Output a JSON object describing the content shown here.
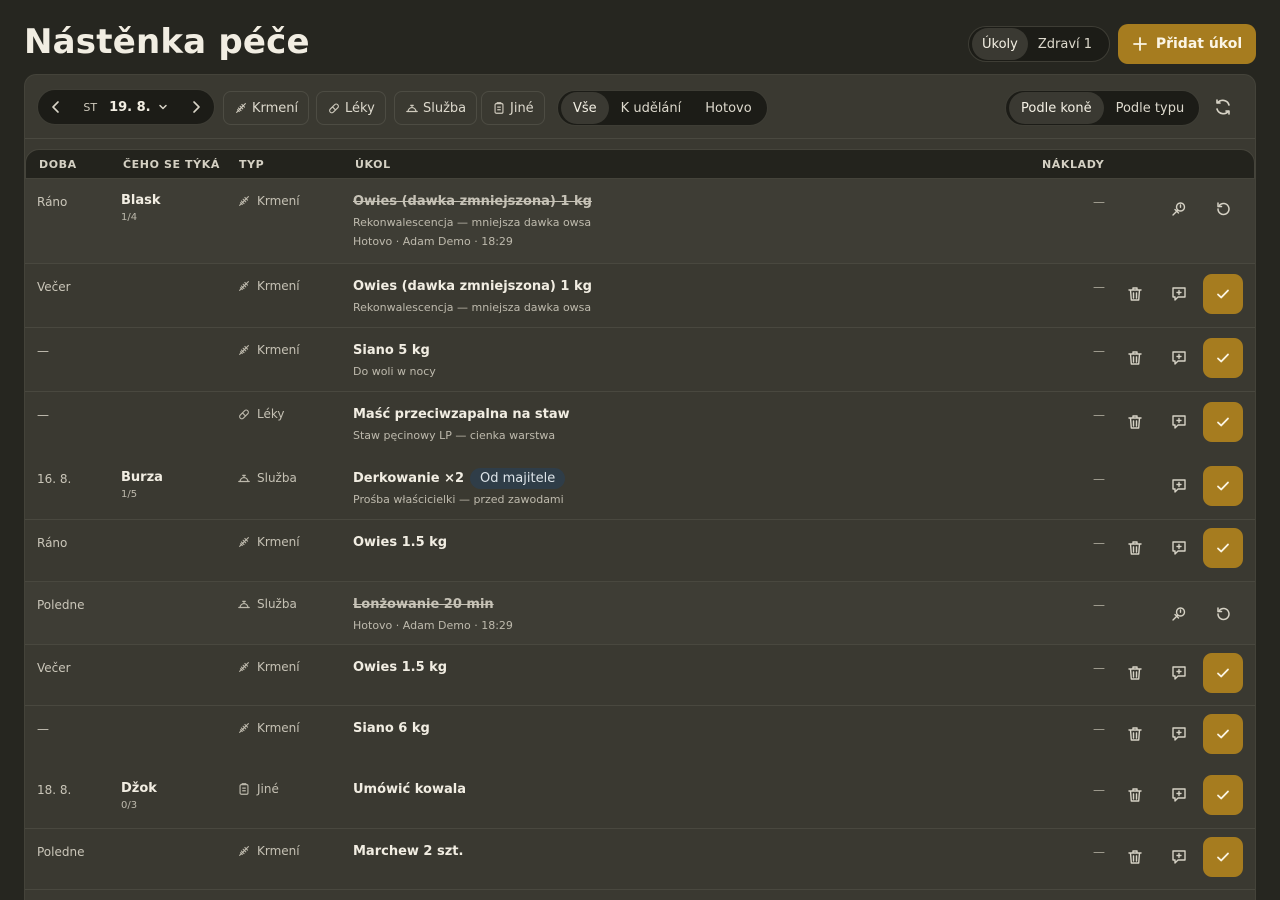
{
  "header": {
    "title": "Nástěnka péče",
    "view_tabs": [
      {
        "label": "Úkoly",
        "active": true
      },
      {
        "label": "Zdraví 1",
        "active": false
      }
    ],
    "add_button_label": "Přidat úkol"
  },
  "toolbar": {
    "date": {
      "weekday": "ST",
      "value": "19. 8."
    },
    "type_chips": [
      {
        "label": "Krmení",
        "icon": "feed-icon"
      },
      {
        "label": "Léky",
        "icon": "pill-icon"
      },
      {
        "label": "Služba",
        "icon": "service-bell-icon"
      },
      {
        "label": "Jiné",
        "icon": "clipboard-icon"
      }
    ],
    "status_filter": [
      {
        "label": "Vše",
        "active": true
      },
      {
        "label": "K udělání",
        "active": false
      },
      {
        "label": "Hotovo",
        "active": false
      }
    ],
    "sort": [
      {
        "label": "Podle koně",
        "active": true
      },
      {
        "label": "Podle typu",
        "active": false
      }
    ]
  },
  "table": {
    "columns": [
      "DOBA",
      "ČEHO SE TÝKÁ",
      "TYP",
      "ÚKOL",
      "NÁKLADY"
    ],
    "rows": [
      {
        "time": "Ráno",
        "horse": "Blask",
        "horse_count": "1/4",
        "type": "Krmení",
        "title": "Owies (dawka zmniejszona) 1 kg",
        "note": "Rekonwalescencja — mniejsza dawka owsa",
        "meta": "Hotovo · Adam Demo · 18:29",
        "cost": "—",
        "done": true
      },
      {
        "time": "Večer",
        "horse": "",
        "horse_count": "",
        "type": "Krmení",
        "title": "Owies (dawka zmniejszona) 1 kg",
        "note": "Rekonwalescencja — mniejsza dawka owsa",
        "meta": "",
        "cost": "—",
        "done": false
      },
      {
        "time": "—",
        "horse": "",
        "horse_count": "",
        "type": "Krmení",
        "title": "Siano 5 kg",
        "note": "Do woli w nocy",
        "meta": "",
        "cost": "—",
        "done": false
      },
      {
        "time": "—",
        "horse": "",
        "horse_count": "",
        "type": "Léky",
        "title": "Maść przeciwzapalna na staw",
        "note": "Staw pęcinowy LP — cienka warstwa",
        "meta": "",
        "cost": "—",
        "done": false
      },
      {
        "time": "16. 8.",
        "horse": "Burza",
        "horse_count": "1/5",
        "type": "Služba",
        "title": "Derkowanie ×2",
        "badge": "Od majitele",
        "note": "Prośba właścicielki — przed zawodami",
        "meta": "",
        "cost": "—",
        "done": false
      },
      {
        "time": "Ráno",
        "horse": "",
        "horse_count": "",
        "type": "Krmení",
        "title": "Owies 1.5 kg",
        "note": "",
        "meta": "",
        "cost": "—",
        "done": false
      },
      {
        "time": "Poledne",
        "horse": "",
        "horse_count": "",
        "type": "Služba",
        "title": "Lonżowanie 20 min",
        "note": "",
        "meta": "Hotovo · Adam Demo · 18:29",
        "cost": "—",
        "done": true
      },
      {
        "time": "Večer",
        "horse": "",
        "horse_count": "",
        "type": "Krmení",
        "title": "Owies 1.5 kg",
        "note": "",
        "meta": "",
        "cost": "—",
        "done": false
      },
      {
        "time": "—",
        "horse": "",
        "horse_count": "",
        "type": "Krmení",
        "title": "Siano 6 kg",
        "note": "",
        "meta": "",
        "cost": "—",
        "done": false
      },
      {
        "time": "18. 8.",
        "horse": "Džok",
        "horse_count": "0/3",
        "type": "Jiné",
        "title": "Umówić kowala",
        "note": "",
        "meta": "",
        "cost": "—",
        "done": false
      },
      {
        "time": "Poledne",
        "horse": "",
        "horse_count": "",
        "type": "Krmení",
        "title": "Marchew 2 szt.",
        "note": "",
        "meta": "",
        "cost": "—",
        "done": false
      }
    ]
  },
  "colors": {
    "accent": "#a67c1f",
    "background": "#262620",
    "panel": "#3a3931",
    "badge": "#2f3d48"
  }
}
